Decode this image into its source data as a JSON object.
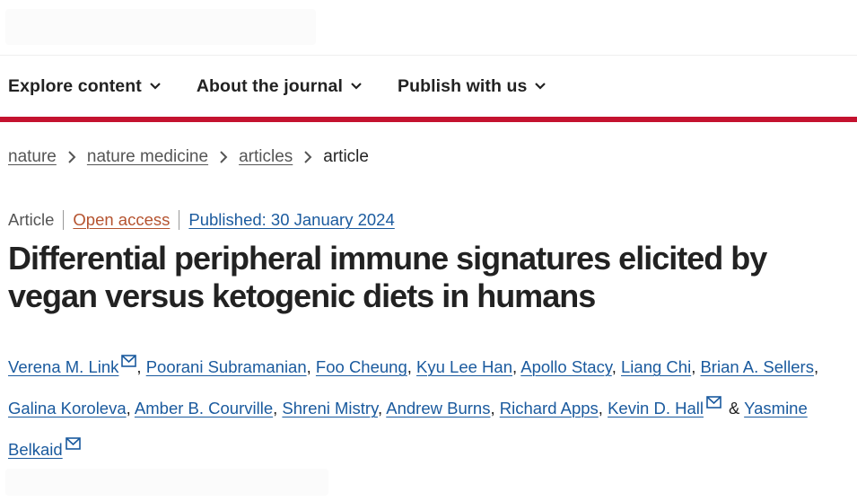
{
  "nav": {
    "items": [
      {
        "label": "Explore content"
      },
      {
        "label": "About the journal"
      },
      {
        "label": "Publish with us"
      }
    ]
  },
  "breadcrumb": {
    "items": [
      "nature",
      "nature medicine",
      "articles"
    ],
    "current": "article"
  },
  "meta": {
    "type": "Article",
    "access": "Open access",
    "published": "Published: 30 January 2024"
  },
  "article": {
    "title_line1": "Differential peripheral immune signatures elicited by",
    "title_line2": "vegan versus ketogenic diets in humans"
  },
  "authors": {
    "list": [
      "Verena M. Link",
      "Poorani Subramanian",
      "Foo Cheung",
      "Kyu Lee Han",
      "Apollo Stacy",
      "Liang Chi",
      "Brian A. Sellers",
      "Galina Koroleva",
      "Amber B. Courville",
      "Shreni Mistry",
      "Andrew Burns",
      "Richard Apps",
      "Kevin D. Hall",
      "Yasmine Belkaid"
    ],
    "separator": ",",
    "conjunction": "&"
  },
  "colors": {
    "accent_red": "#c4122f",
    "link_blue": "#1a5a9e",
    "open_access": "#b5532f"
  }
}
